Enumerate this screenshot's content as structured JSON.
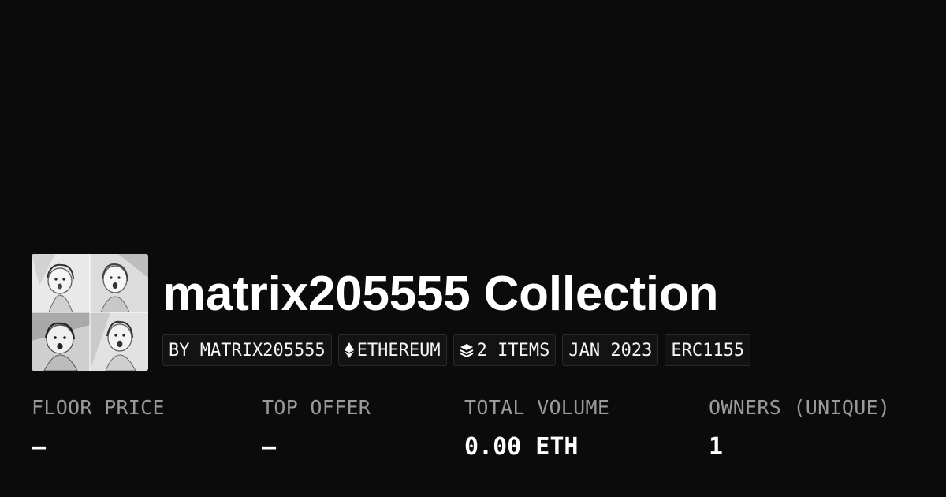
{
  "collection": {
    "name": "matrix205555 Collection",
    "badges": [
      {
        "label": "BY MATRIX205555",
        "icon": null
      },
      {
        "label": "ETHEREUM",
        "icon": "ethereum-icon"
      },
      {
        "label": "2 ITEMS",
        "icon": "layers-icon"
      },
      {
        "label": "JAN 2023",
        "icon": null
      },
      {
        "label": "ERC1155",
        "icon": null
      }
    ],
    "thumbnail": {
      "description_icon": "collection-thumbnail"
    }
  },
  "stats": [
    {
      "label": "FLOOR PRICE",
      "value": "–"
    },
    {
      "label": "TOP OFFER",
      "value": "–"
    },
    {
      "label": "TOTAL VOLUME",
      "value": "0.00 ETH"
    },
    {
      "label": "OWNERS (UNIQUE)",
      "value": "1"
    }
  ],
  "colors": {
    "background": "#0b0b0b",
    "text": "#ffffff",
    "muted": "#9a9a9a",
    "badge_border": "#2a2a2a"
  }
}
